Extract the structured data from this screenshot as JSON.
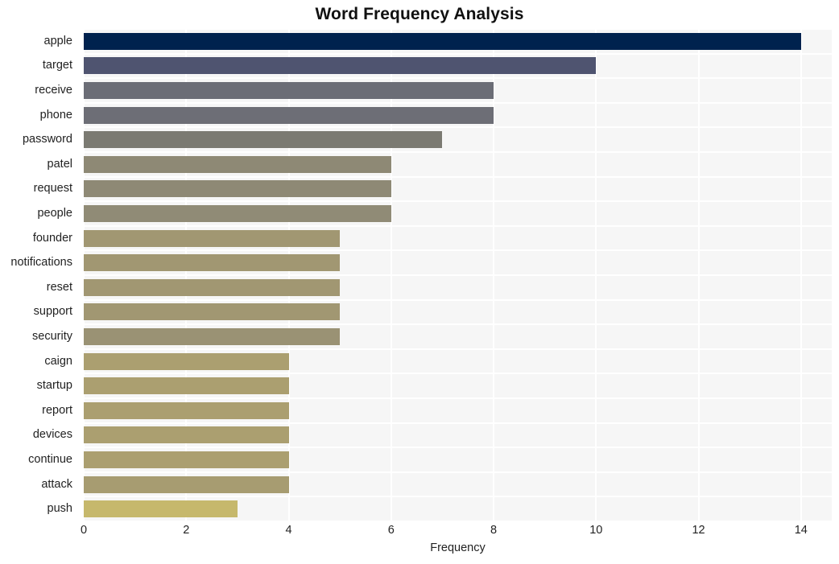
{
  "chart_data": {
    "type": "bar",
    "orientation": "horizontal",
    "title": "Word Frequency Analysis",
    "xlabel": "Frequency",
    "ylabel": "",
    "categories": [
      "apple",
      "target",
      "receive",
      "phone",
      "password",
      "patel",
      "request",
      "people",
      "founder",
      "notifications",
      "reset",
      "support",
      "security",
      "caign",
      "startup",
      "report",
      "devices",
      "continue",
      "attack",
      "push"
    ],
    "values": [
      14,
      10,
      8,
      8,
      7,
      6,
      6,
      6,
      5,
      5,
      5,
      5,
      5,
      4,
      4,
      4,
      4,
      4,
      4,
      3
    ],
    "bar_colors": [
      "#00224e",
      "#4f5470",
      "#6b6d76",
      "#6d6e76",
      "#7b7a72",
      "#8e8975",
      "#8e8975",
      "#908b76",
      "#a19772",
      "#a19772",
      "#a19772",
      "#a19772",
      "#9a9274",
      "#ab9f70",
      "#ab9f70",
      "#ab9f70",
      "#ab9f70",
      "#ab9f70",
      "#a79c71",
      "#c6b86c"
    ],
    "xlim": [
      0,
      14.6
    ],
    "xticks": [
      0,
      2,
      4,
      6,
      8,
      10,
      12,
      14
    ],
    "xtick_labels": [
      "0",
      "2",
      "4",
      "6",
      "8",
      "10",
      "12",
      "14"
    ],
    "grid": true,
    "grid_color": "#ffffff",
    "plot_background": "#f6f6f6",
    "figure_background": "#ffffff",
    "legend": null,
    "colormap": "cividis"
  }
}
